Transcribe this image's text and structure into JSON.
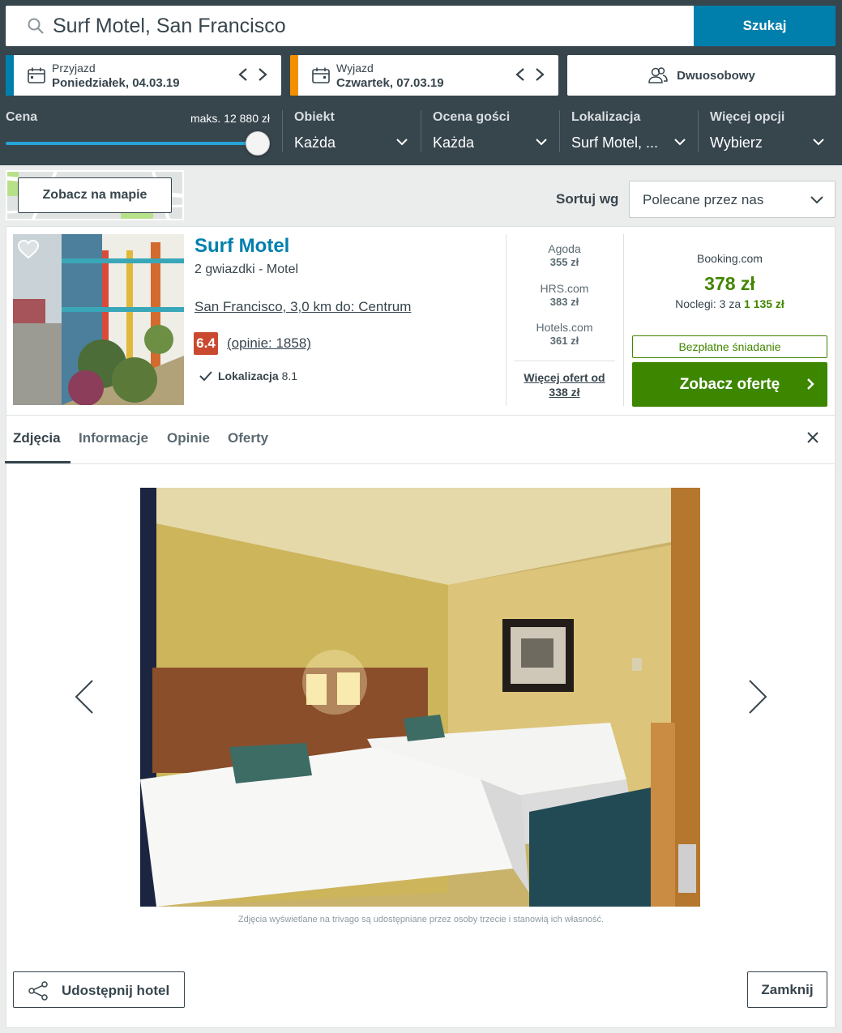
{
  "search": {
    "query": "Surf Motel, San Francisco",
    "button": "Szukaj"
  },
  "checkin": {
    "label": "Przyjazd",
    "value": "Poniedziałek, 04.03.19",
    "color": "#007fad"
  },
  "checkout": {
    "label": "Wyjazd",
    "value": "Czwartek, 07.03.19",
    "color": "#f48f00"
  },
  "room": {
    "label": "Dwuosobowy"
  },
  "filters": {
    "price": {
      "label": "Cena",
      "max_label": "maks. 12 880 zł",
      "slider_fraction": 1.0
    },
    "property": {
      "label": "Obiekt",
      "value": "Każda"
    },
    "rating": {
      "label": "Ocena gości",
      "value": "Każda"
    },
    "location": {
      "label": "Lokalizacja",
      "value": "Surf Motel, ..."
    },
    "more": {
      "label": "Więcej opcji",
      "value": "Wybierz"
    }
  },
  "map": {
    "button": "Zobacz na mapie"
  },
  "sort": {
    "label": "Sortuj wg",
    "value": "Polecane przez nas"
  },
  "hotel": {
    "name": "Surf Motel",
    "stars_type": "2 gwiazdki -  Motel",
    "location": "San Francisco, 3,0 km do: Centrum",
    "rating": "6.4",
    "reviews": "(opinie: 1858)",
    "feature_label": "Lokalizacja",
    "feature_score": "8.1"
  },
  "offers": [
    {
      "site": "Agoda",
      "price": "355 zł"
    },
    {
      "site": "HRS.com",
      "price": "383 zł"
    },
    {
      "site": "Hotels.com",
      "price": "361 zł"
    }
  ],
  "more_offers": "Więcej ofert od 338 zł",
  "best": {
    "site": "Booking.com",
    "price": "378 zł",
    "nights_prefix": "Noclegi: 3 za",
    "nights_total": "1 135 zł",
    "badge": "Bezpłatne śniadanie",
    "cta": "Zobacz ofertę"
  },
  "tabs": [
    {
      "label": "Zdjęcia",
      "active": true
    },
    {
      "label": "Informacje",
      "active": false
    },
    {
      "label": "Opinie",
      "active": false
    },
    {
      "label": "Oferty",
      "active": false
    }
  ],
  "gallery": {
    "caption": "Zdjęcia wyświetlane na trivago są udostępniane przez osoby trzecie i stanowią ich własność."
  },
  "footer": {
    "share": "Udostępnij hotel",
    "close": "Zamknij"
  }
}
